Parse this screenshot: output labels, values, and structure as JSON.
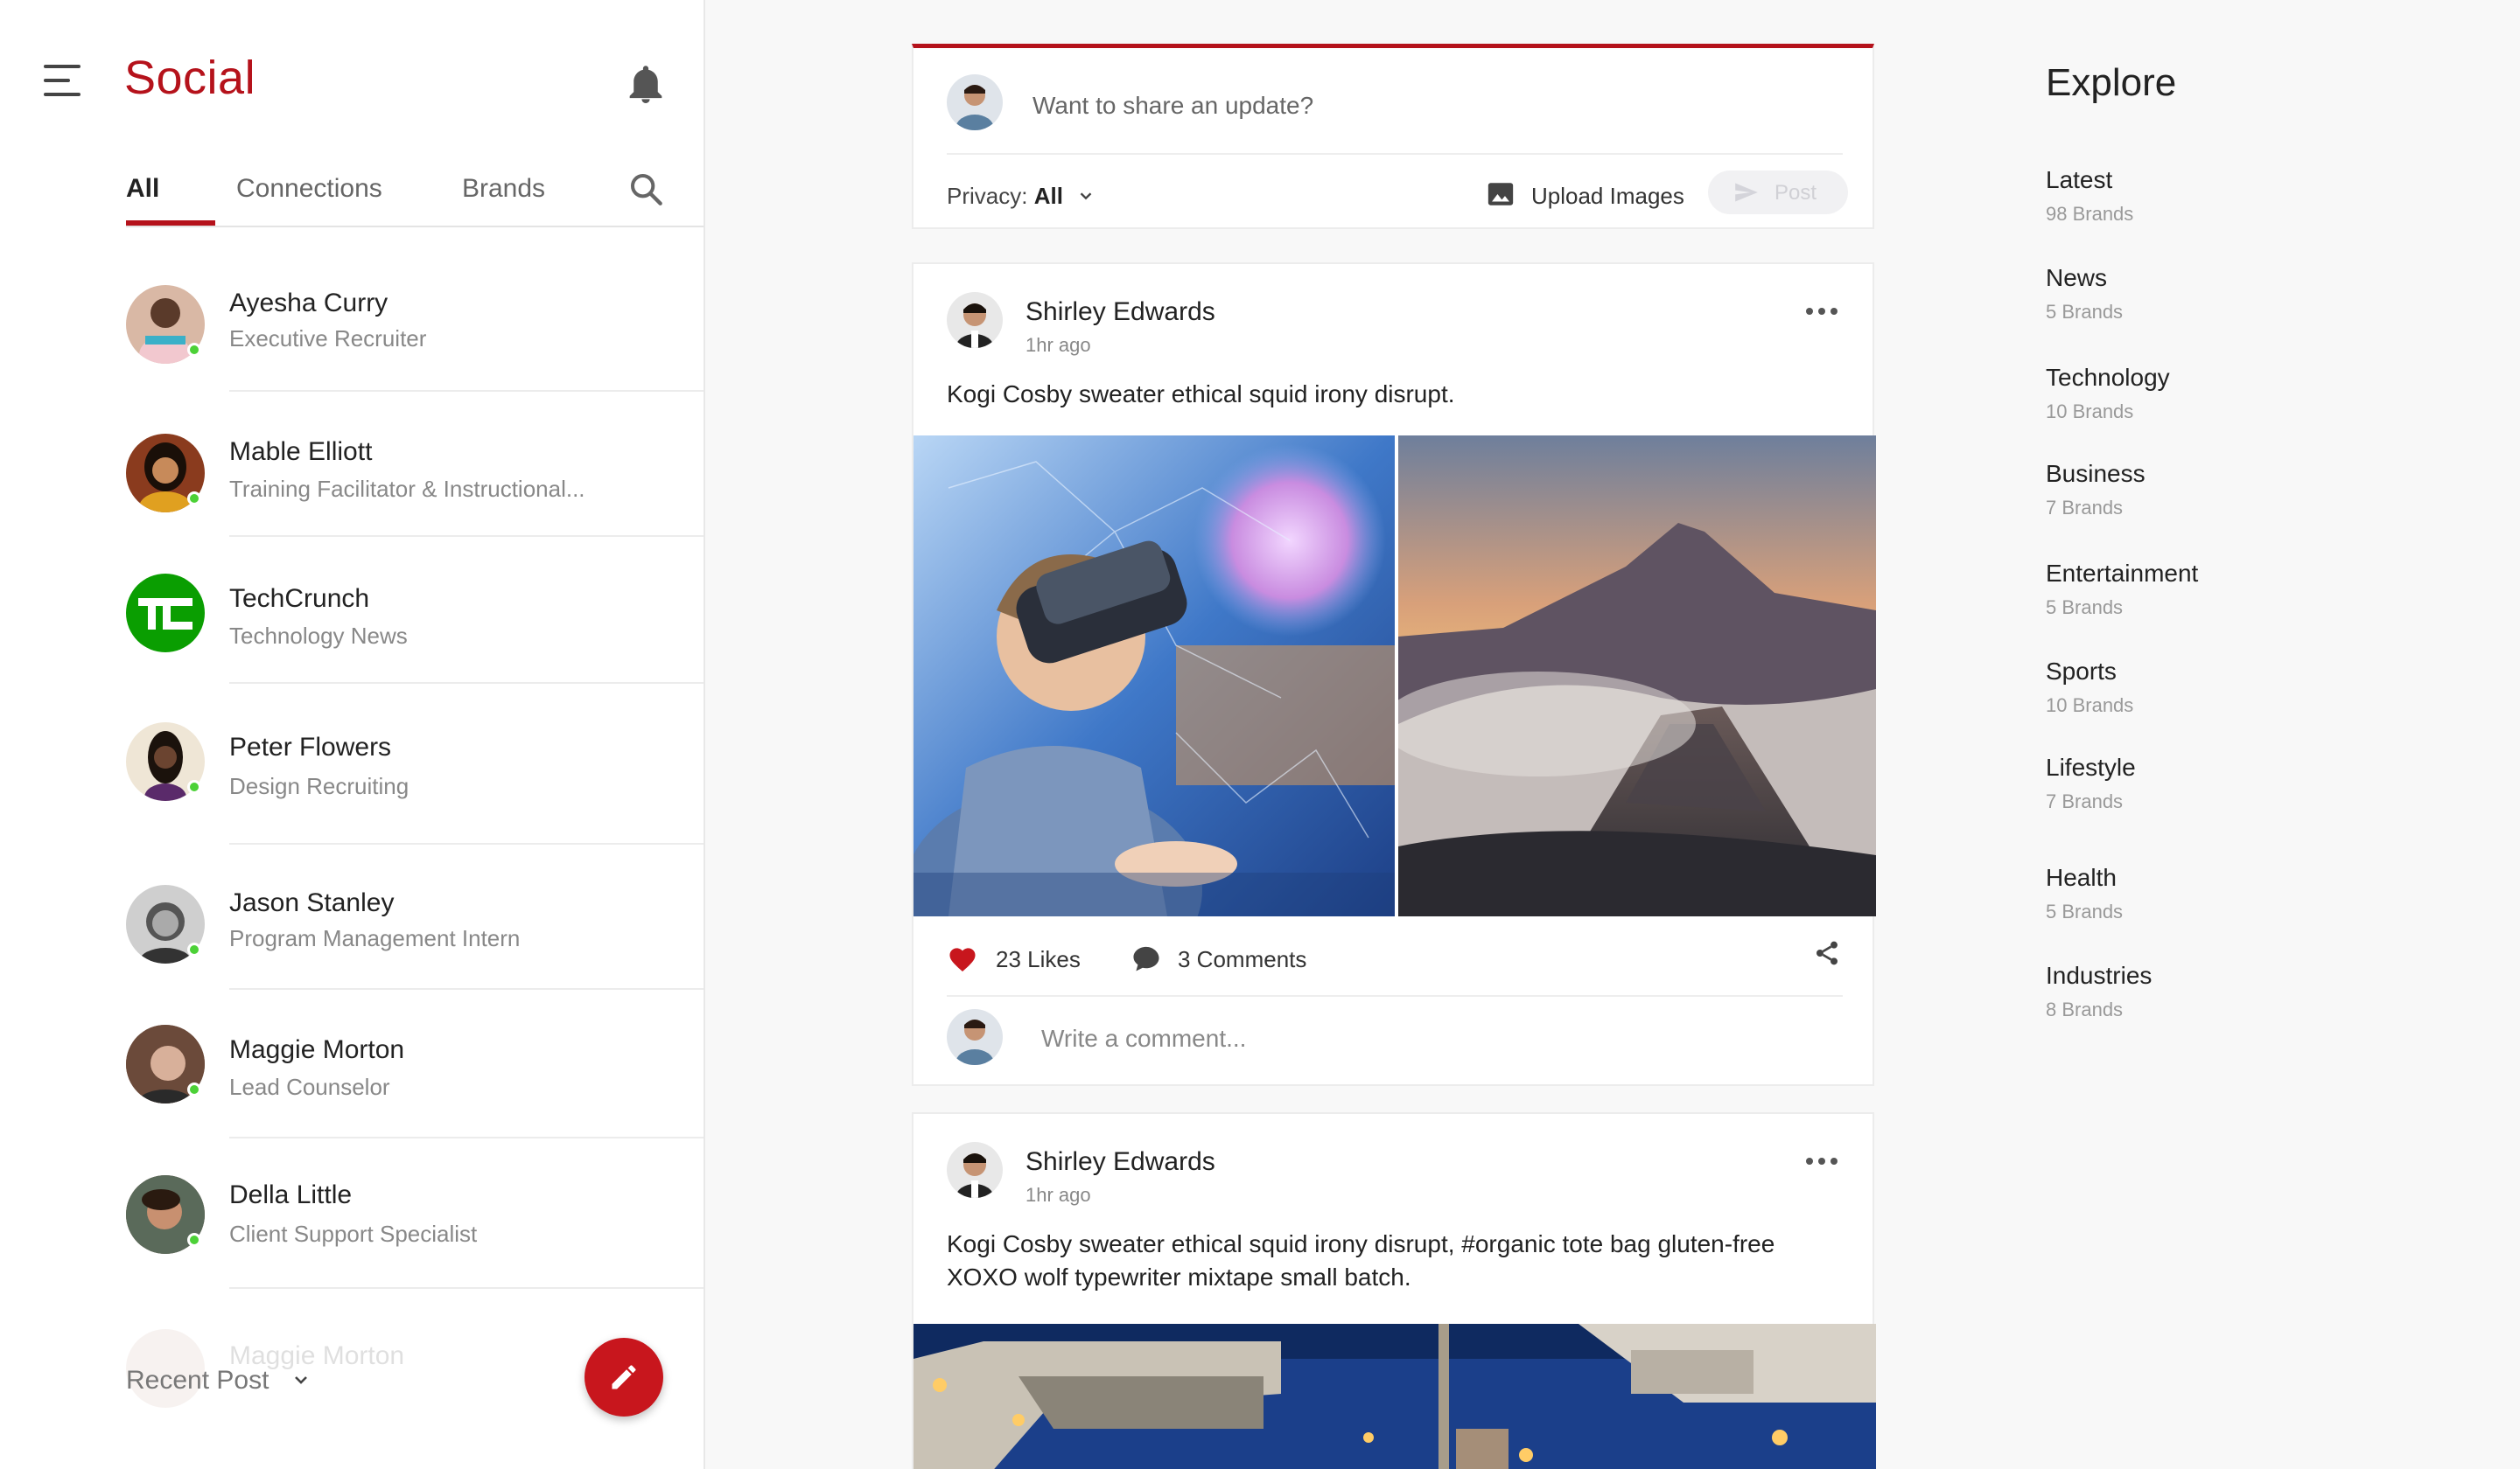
{
  "app": {
    "title": "Social"
  },
  "sidebar": {
    "tabs": [
      {
        "label": "All",
        "active": true
      },
      {
        "label": "Connections",
        "active": false
      },
      {
        "label": "Brands",
        "active": false
      }
    ],
    "contacts": [
      {
        "name": "Ayesha Curry",
        "role": "Executive Recruiter",
        "online": true,
        "avatar_color": "#d9b8a5"
      },
      {
        "name": "Mable Elliott",
        "role": "Training Facilitator & Instructional...",
        "online": true,
        "avatar_color": "#8a3b1e"
      },
      {
        "name": "TechCrunch",
        "role": "Technology News",
        "online": false,
        "avatar_color": "#0a9e01"
      },
      {
        "name": "Peter Flowers",
        "role": "Design Recruiting",
        "online": true,
        "avatar_color": "#5a4436"
      },
      {
        "name": "Jason Stanley",
        "role": "Program Management Intern",
        "online": true,
        "avatar_color": "#777777"
      },
      {
        "name": "Maggie Morton",
        "role": "Lead Counselor",
        "online": true,
        "avatar_color": "#9b6a55"
      },
      {
        "name": "Della Little",
        "role": "Client Support Specialist",
        "online": true,
        "avatar_color": "#7a5a46"
      }
    ],
    "faded_contact": "Maggie Morton",
    "recent_post_label": "Recent Post"
  },
  "composer": {
    "placeholder": "Want to share an update?",
    "privacy_label": "Privacy:",
    "privacy_value": "All",
    "upload_label": "Upload Images",
    "post_label": "Post"
  },
  "posts": [
    {
      "author": "Shirley Edwards",
      "time": "1hr ago",
      "text": "Kogi Cosby sweater ethical squid irony disrupt.",
      "likes": "23 Likes",
      "comments": "3 Comments",
      "comment_placeholder": "Write a comment..."
    },
    {
      "author": "Shirley Edwards",
      "time": "1hr ago",
      "text": "Kogi Cosby sweater ethical squid irony disrupt, #organic tote bag gluten-free XOXO wolf typewriter mixtape small batch."
    }
  ],
  "explore": {
    "title": "Explore",
    "categories": [
      {
        "name": "Latest",
        "count": "98 Brands"
      },
      {
        "name": "News",
        "count": "5 Brands"
      },
      {
        "name": "Technology",
        "count": "10 Brands"
      },
      {
        "name": "Business",
        "count": "7 Brands"
      },
      {
        "name": "Entertainment",
        "count": "5 Brands"
      },
      {
        "name": "Sports",
        "count": "10 Brands"
      },
      {
        "name": "Lifestyle",
        "count": "7 Brands"
      },
      {
        "name": "Health",
        "count": "5 Brands"
      },
      {
        "name": "Industries",
        "count": "8 Brands"
      }
    ]
  },
  "colors": {
    "accent": "#b5121b",
    "online": "#4cd137",
    "techcrunch": "#0a9e01"
  }
}
